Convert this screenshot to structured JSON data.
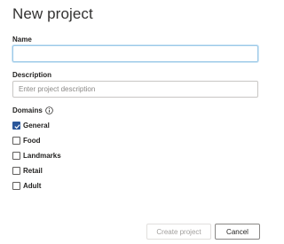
{
  "dialog": {
    "title": "New project",
    "name": {
      "label": "Name",
      "value": "",
      "placeholder": ""
    },
    "description": {
      "label": "Description",
      "value": "",
      "placeholder": "Enter project description"
    },
    "domains": {
      "label": "Domains",
      "info_icon": "info-icon",
      "items": [
        {
          "label": "General",
          "checked": true
        },
        {
          "label": "Food",
          "checked": false
        },
        {
          "label": "Landmarks",
          "checked": false
        },
        {
          "label": "Retail",
          "checked": false
        },
        {
          "label": "Adult",
          "checked": false
        }
      ]
    },
    "buttons": {
      "create_label": "Create project",
      "cancel_label": "Cancel"
    }
  },
  "colors": {
    "accent": "#2b579a",
    "focus_border": "#9cc9e8",
    "disabled_text": "#a19f9d"
  }
}
